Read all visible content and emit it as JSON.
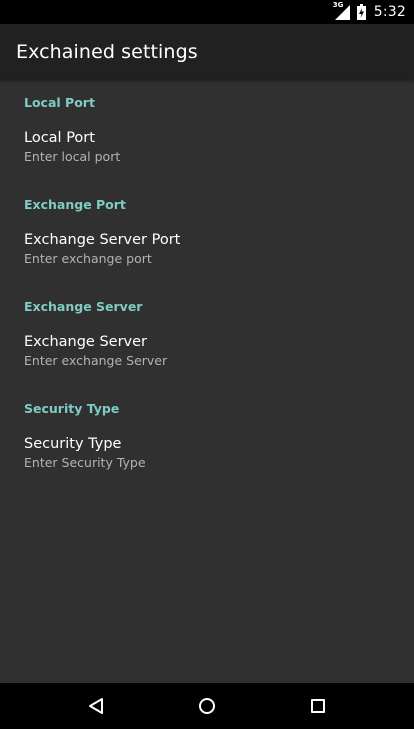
{
  "status_bar": {
    "network": "3G",
    "time": "5:32",
    "icons": [
      "signal-icon",
      "battery-icon"
    ]
  },
  "app_bar": {
    "title": "Exchained settings"
  },
  "preferences": [
    {
      "category": "Local Port",
      "title": "Local Port",
      "summary": "Enter local port"
    },
    {
      "category": "Exchange Port",
      "title": "Exchange Server Port",
      "summary": "Enter exchange port"
    },
    {
      "category": "Exchange Server",
      "title": "Exchange Server",
      "summary": "Enter exchange Server"
    },
    {
      "category": "Security Type",
      "title": "Security Type",
      "summary": "Enter Security Type"
    }
  ],
  "nav_bar": {
    "icons": [
      "back-icon",
      "home-icon",
      "recents-icon"
    ]
  },
  "colors": {
    "accent": "#80cbc4",
    "background": "#303030",
    "app_bar": "#212121"
  }
}
